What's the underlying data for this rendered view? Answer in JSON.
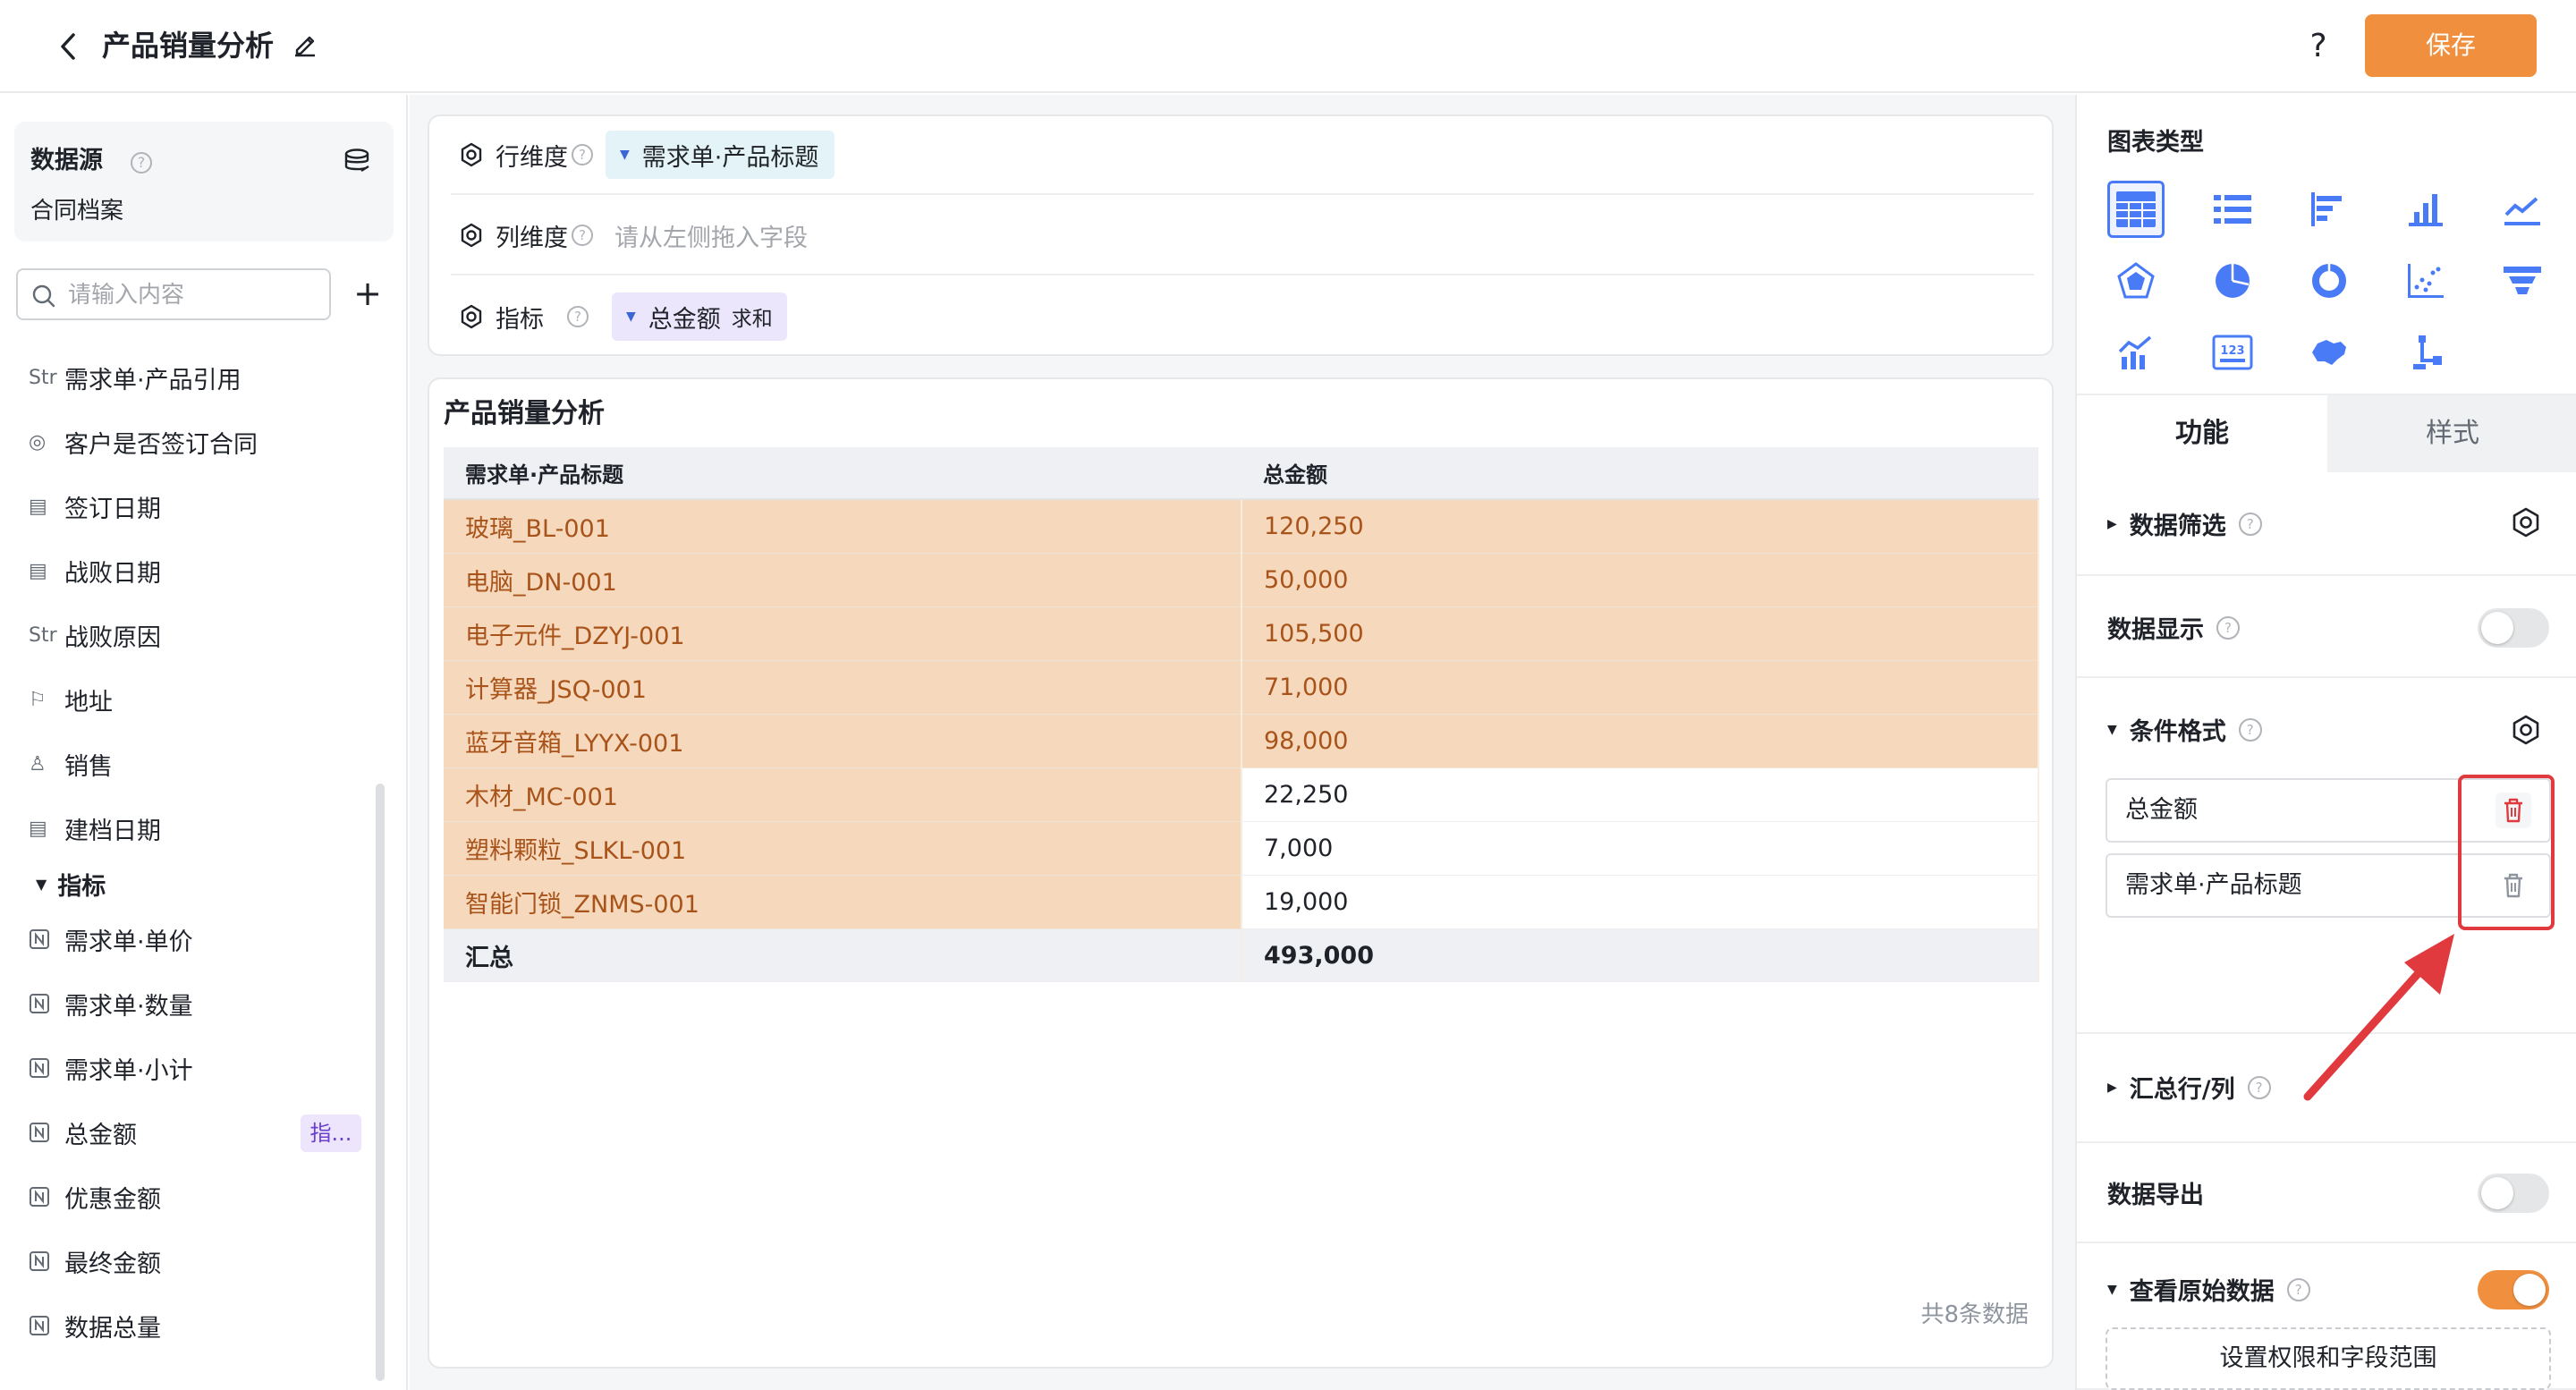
{
  "header": {
    "title": "产品销量分析",
    "help_label": "?",
    "save_label": "保存"
  },
  "sidebar": {
    "datasource_title": "数据源",
    "datasource_name": "合同档案",
    "search_placeholder": "请输入内容",
    "add_label": "+",
    "fields": [
      {
        "icon": "Str",
        "icon_name": "string-type-icon",
        "label": "需求单·产品引用"
      },
      {
        "icon": "◎",
        "icon_name": "option-type-icon",
        "label": "客户是否签订合同"
      },
      {
        "icon": "▤",
        "icon_name": "date-type-icon",
        "label": "签订日期"
      },
      {
        "icon": "▤",
        "icon_name": "date-type-icon",
        "label": "战败日期"
      },
      {
        "icon": "Str",
        "icon_name": "string-type-icon",
        "label": "战败原因"
      },
      {
        "icon": "⚐",
        "icon_name": "address-type-icon",
        "label": "地址"
      },
      {
        "icon": "♙",
        "icon_name": "user-type-icon",
        "label": "销售"
      },
      {
        "icon": "▤",
        "icon_name": "date-type-icon",
        "label": "建档日期"
      }
    ],
    "measure_group": "指标",
    "measures": [
      {
        "icon": "N",
        "label": "需求单·单价",
        "badge": ""
      },
      {
        "icon": "N",
        "label": "需求单·数量",
        "badge": ""
      },
      {
        "icon": "N",
        "label": "需求单·小计",
        "badge": ""
      },
      {
        "icon": "N",
        "label": "总金额",
        "badge": "指..."
      },
      {
        "icon": "N",
        "label": "优惠金额",
        "badge": ""
      },
      {
        "icon": "N",
        "label": "最终金额",
        "badge": ""
      },
      {
        "icon": "N",
        "label": "数据总量",
        "badge": ""
      }
    ]
  },
  "config": {
    "row_label": "行维度",
    "row_value": "需求单·产品标题",
    "col_label": "列维度",
    "col_placeholder": "请从左侧拖入字段",
    "measure_label": "指标",
    "measure_value": "总金额",
    "measure_agg": "求和"
  },
  "table": {
    "title": "产品销量分析",
    "headers": [
      "需求单·产品标题",
      "总金额"
    ],
    "rows": [
      {
        "name": "玻璃_BL-001",
        "value": "120,250",
        "highlight_value": true
      },
      {
        "name": "电脑_DN-001",
        "value": "50,000",
        "highlight_value": true
      },
      {
        "name": "电子元件_DZYJ-001",
        "value": "105,500",
        "highlight_value": true
      },
      {
        "name": "计算器_JSQ-001",
        "value": "71,000",
        "highlight_value": true
      },
      {
        "name": "蓝牙音箱_LYYX-001",
        "value": "98,000",
        "highlight_value": true
      },
      {
        "name": "木材_MC-001",
        "value": "22,250",
        "highlight_value": false
      },
      {
        "name": "塑料颗粒_SLKL-001",
        "value": "7,000",
        "highlight_value": false
      },
      {
        "name": "智能门锁_ZNMS-001",
        "value": "19,000",
        "highlight_value": false
      }
    ],
    "total_label": "汇总",
    "total_value": "493,000",
    "row_count": "共8条数据"
  },
  "right_panel": {
    "chart_type_title": "图表类型",
    "tabs": [
      "功能",
      "样式"
    ],
    "data_filter": "数据筛选",
    "data_display": "数据显示",
    "data_display_on": false,
    "conditional_format": "条件格式",
    "conditions": [
      "总金额",
      "需求单·产品标题"
    ],
    "summary": "汇总行/列",
    "data_export": "数据导出",
    "data_export_on": false,
    "raw_data": "查看原始数据",
    "raw_data_on": true,
    "permission_button": "设置权限和字段范围"
  },
  "colors": {
    "accent_orange": "#f0903f",
    "highlight_bg": "#f6d9bd",
    "highlight_text": "#a8531a",
    "chart_icon_blue": "#4a7bf7",
    "annotation_red": "#e0393e"
  }
}
